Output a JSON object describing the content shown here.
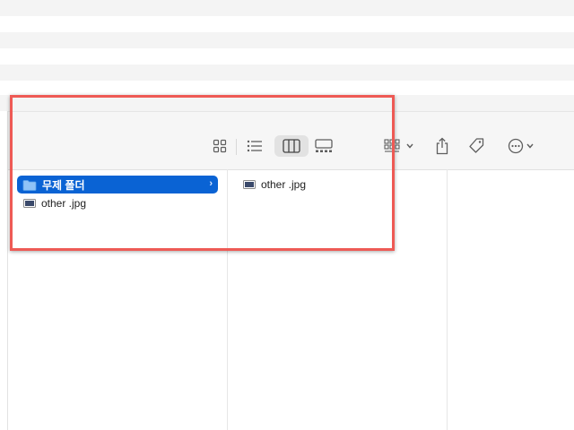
{
  "columns": [
    {
      "items": [
        {
          "label": "무제 폴더",
          "type": "folder",
          "selected": true,
          "icon": "folder-icon"
        },
        {
          "label": "other .jpg",
          "type": "image",
          "selected": false,
          "icon": "image-file-icon"
        }
      ]
    },
    {
      "items": [
        {
          "label": "other .jpg",
          "type": "image",
          "selected": false,
          "icon": "image-file-icon"
        }
      ]
    }
  ],
  "toolbar": {
    "active_view": "columns",
    "icons": [
      "icon-view-icon",
      "list-view-icon",
      "column-view-icon",
      "gallery-view-icon",
      "group-icon",
      "share-icon",
      "tag-icon",
      "more-icon"
    ]
  },
  "colors": {
    "selection": "#0a63d4",
    "highlight": "#ee5a55"
  }
}
